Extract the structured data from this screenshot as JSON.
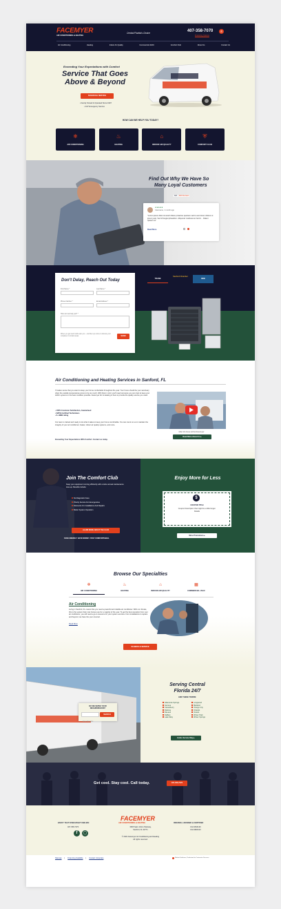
{
  "colors": {
    "navy": "#13152f",
    "orange": "#e2401d",
    "green": "#23523a",
    "cream": "#f4f3e3"
  },
  "header": {
    "logo_name": "FACEMYER",
    "logo_tagline": "AIR CONDITIONING & HEATING",
    "location": "Central Florida's Choice",
    "phone": "407-358-7070",
    "financing": "Financing Options",
    "nav": [
      "Air Conditioning",
      "Heating",
      "Indoor Air Quality",
      "Commercial HVAC",
      "Comfort Club",
      "About Us",
      "Contact Us"
    ]
  },
  "hero": {
    "eyebrow": "Exceeding Your Expectations with Comfort",
    "title_line1": "Service That Goes",
    "title_line2": "Above & Beyond",
    "cta": "SCHEDULE SERVICE",
    "bullet1": "• Family Owned & Operated Since 1997",
    "bullet2": "• 24/7 Emergency Service"
  },
  "help": {
    "heading": "HOW CAN WE HELP YOU TODAY?",
    "cards": [
      {
        "label": "AIR CONDITIONING",
        "icon": "snowflake-icon"
      },
      {
        "label": "HEATING",
        "icon": "flame-icon"
      },
      {
        "label": "INDOOR AIR QUALITY",
        "icon": "house-air-icon"
      },
      {
        "label": "COMFORT CLUB",
        "icon": "shield-icon"
      }
    ]
  },
  "reviews": {
    "title_line1": "Find Out Why We Have So",
    "title_line2": "Many Loyal Customers",
    "rating": "4.9",
    "rating_count": "392 Reviews",
    "stars": "★★★★★",
    "reviewer": "Username, 1 month ago",
    "text": "\"Lorem ipsum dolor sit amet! dolore proiectus quentem sed to aunt lorem dolorur et ipsum justo. Sed id feugiat phasellum. Aliquorari modisvenum facnit ... Daleni quasum te\"",
    "read_more": "Read More"
  },
  "contact": {
    "title": "Don't Delay, Reach Out Today",
    "first_name": "First Name *",
    "last_name": "Last Name *",
    "phone": "Phone Number *",
    "email": "Email Address *",
    "message": "How can we help you? *",
    "disclaimer": "When you get touch with team you... and then up a time to discuss your complete in contact areas.",
    "submit": "SEND",
    "badges": [
      "TRANE",
      "Sanford Chamber",
      "BBB",
      "Sanford Florida"
    ]
  },
  "services": {
    "title": "Air Conditioning and Heating Services in Sanford, FL",
    "para1": "If makes sense that you want to keep your home comfortable throughout the year. Your home should be your sanctuary when the outside temperatures prove to be too much. With that in mind, you'll need someone you can trust to keep your HVAC systems in the best condition possible. Facemyer AC & Heating is here to provide the quality service you need.",
    "bullets": [
      "• 100% Customer Satisfaction, Guaranteed",
      "• NATE-Certified Technicians",
      "• A+ BBB rating"
    ],
    "para2": "Our team is trained and ready to do what it takes to keep your home comfortable. You can count on us to maintain the integrity of your air conditioner, heater, indoor air quality systems, and more.",
    "closing": "Exceeding Your Expectations With Comfort. Contact us today.",
    "video_caption": "Meet the Dave Alcher/Facemyer",
    "about_btn": "Read More About Us ▸"
  },
  "club": {
    "title": "Join The Comfort Club",
    "desc": "Keep your equipment running efficiently with a twice annual maintenance tune-up. Benefits include:",
    "items": [
      "No Diagnostic Fees",
      "Priority Service For Emergencies",
      "Discounts On Installations And Repairs",
      "Better System Operation"
    ],
    "cta": "LEARN MORE ABOUT THE CLUB",
    "tagline": "SAVE ENERGY. SAVE MONEY. STAY COMFORTABLE."
  },
  "promo": {
    "title": "Enjoy More for Less",
    "coupon_title": "COUPON TITLE",
    "coupon_text": "Coupon Description that might be a little longer. Details",
    "cta": "More Promotions ▸"
  },
  "specialties": {
    "title": "Browse Our Specialties",
    "tabs": [
      "AIR CONDITIONING",
      "HEATING",
      "INDOOR AIR QUALITY",
      "COMMERCIAL HVAC"
    ],
    "sub": "Air Conditioning",
    "text": "Living in Sanford, FL means that you need a powerful and reliable air conditioner. With our climate, this is the system that most homes use for a majority of the year. To get the best operation from your air conditioner, you will need a go-to resource for your system services. From installations to repairs and beyond, we have the your covered.",
    "read_more": "Read More",
    "cta": "SCHEDULE SERVICE"
  },
  "area": {
    "serve_title": "DO WE SERVE YOUR NEIGHBORHOOD?",
    "zip_placeholder": "Enter Zip Code",
    "search": "SEARCH",
    "title_line1": "Serving Central",
    "title_line2": "Florida 24/7",
    "sub": "AND THESE TOWNS:",
    "col1": [
      "Altamonte Springs",
      "Geneva",
      "Casselberry",
      "Deltona",
      "DeLand",
      "DeBary",
      "Lake Mary"
    ],
    "col2": [
      "Longwood",
      "Maitland",
      "Orange City",
      "Orlando",
      "Oviedo",
      "Winter Park",
      "Winter Springs"
    ],
    "cta": "Entire Service Map ▸"
  },
  "band": {
    "text": "Get cool. Stay cool. Call today.",
    "cta": "407-358-7070"
  },
  "footer": {
    "left_title": "ENJOY THAT FIXED-RIGHT FEELING",
    "left_phone": "407-358-7070",
    "address1": "3605 Saint Johns Parkway,",
    "address2": "Sanford, FL 32771",
    "copyright": "© 2021 Facemyer Air Conditioning and Heating",
    "rights": "All rights reserved.",
    "right_title": "INSURED, LICENSED & CERTIFIED",
    "lic1": "CAC1816126",
    "lic2": "CAC1820413",
    "links": [
      "Sitemap",
      "Financing Available",
      "Contact Corporate"
    ],
    "credit": "Market Solutions, Dedicated to Contractor Success"
  }
}
